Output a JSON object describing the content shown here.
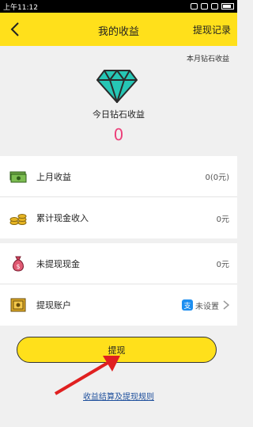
{
  "status_bar": {
    "time": "上午11:12"
  },
  "nav": {
    "back_icon": "chevron-left-icon",
    "title": "我的收益",
    "right_link": "提现记录"
  },
  "hero": {
    "month_link": "本月钻石收益",
    "icon": "diamond-icon",
    "label": "今日钻石收益",
    "value": "0",
    "value_color": "#ec407a"
  },
  "rows": [
    {
      "icon": "money-stack-icon",
      "label": "上月收益",
      "value": "0(0元)"
    },
    {
      "icon": "coin-stack-icon",
      "label": "累计现金收入",
      "value": "0元"
    },
    {
      "icon": "money-bag-icon",
      "label": "未提现现金",
      "value": "0元"
    },
    {
      "icon": "safe-icon",
      "label": "提现账户",
      "value": "未设置",
      "account_icon": "alipay-icon",
      "account_icon_glyph": "支"
    }
  ],
  "withdraw_button": {
    "label": "提现",
    "color": "#ffe01b"
  },
  "rules_link": "收益结算及提现规则",
  "colors": {
    "accent": "#ffe01b",
    "link": "#1e4f9c"
  }
}
